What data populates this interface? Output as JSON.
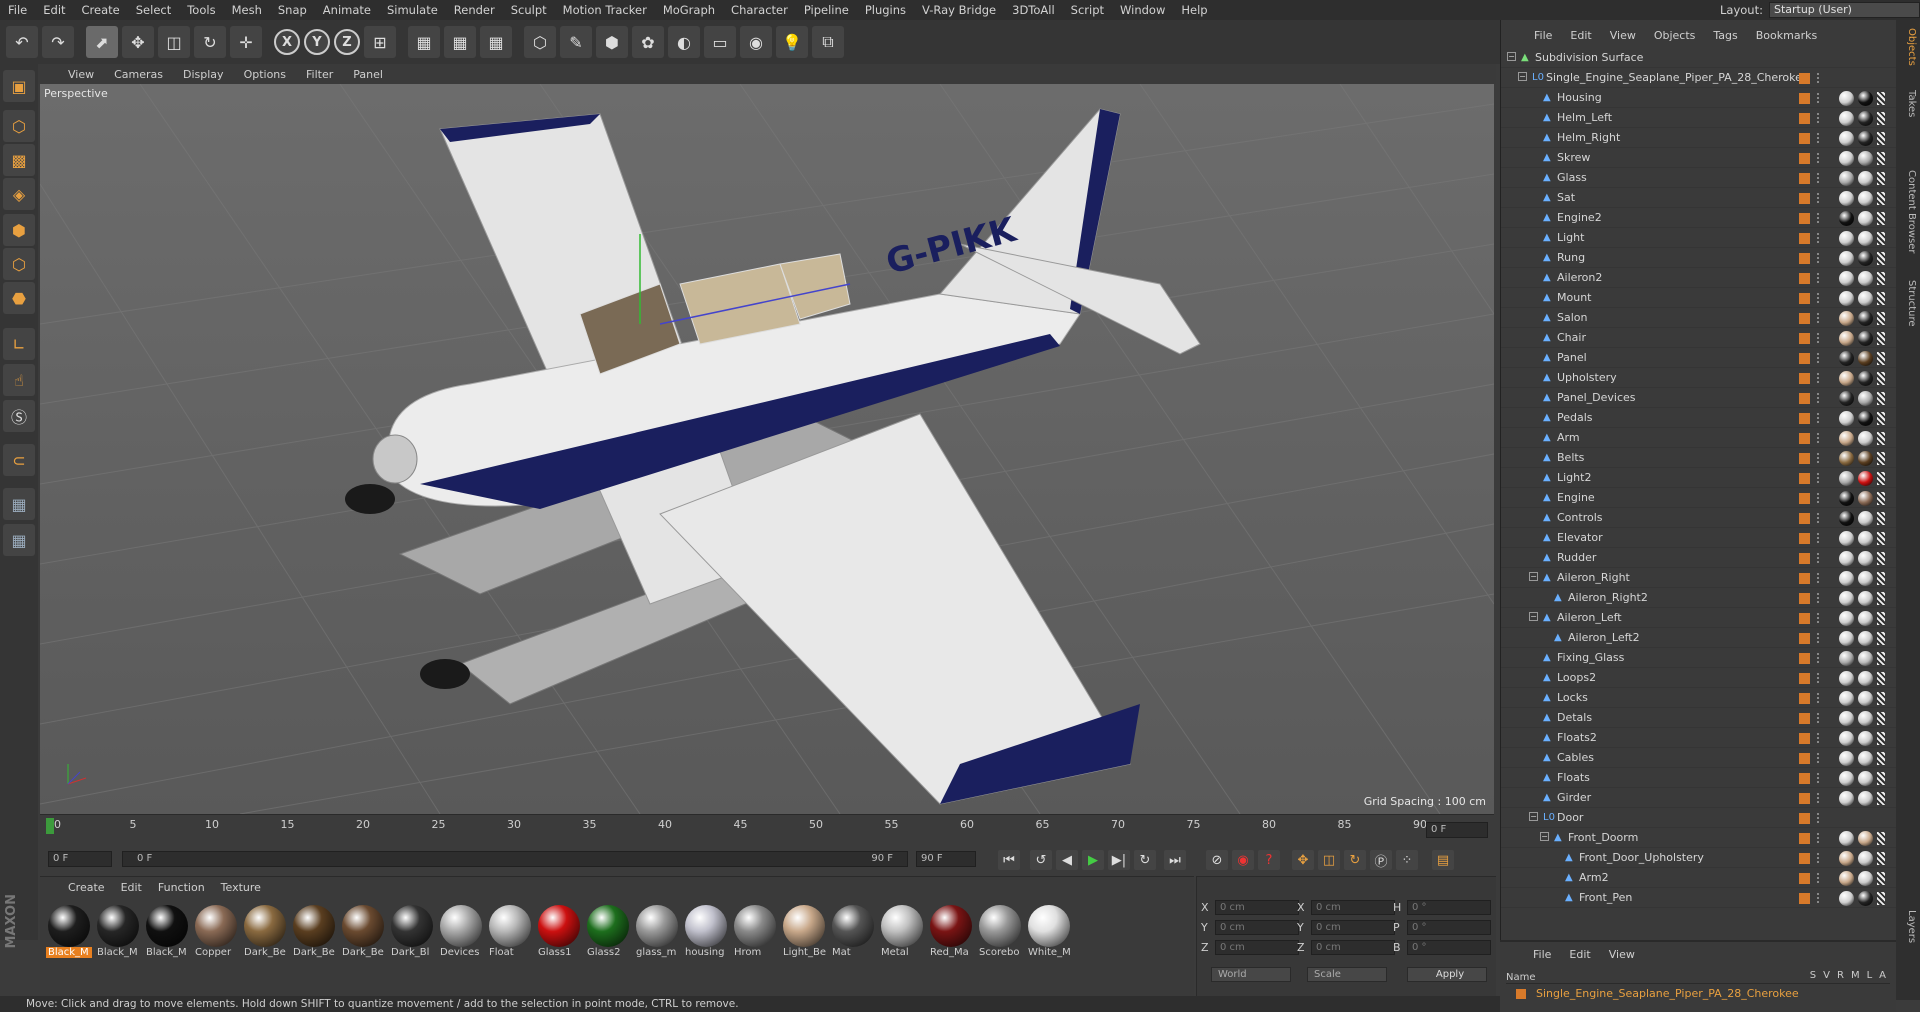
{
  "menubar": [
    "File",
    "Edit",
    "Create",
    "Select",
    "Tools",
    "Mesh",
    "Snap",
    "Animate",
    "Simulate",
    "Render",
    "Sculpt",
    "Motion Tracker",
    "MoGraph",
    "Character",
    "Pipeline",
    "Plugins",
    "V-Ray Bridge",
    "3DToAll",
    "Script",
    "Window",
    "Help"
  ],
  "layout": {
    "label": "Layout:",
    "value": "Startup (User)"
  },
  "toolbar_icons": [
    "undo-icon",
    "redo-icon",
    "live-select-icon",
    "move-icon",
    "scale-icon",
    "rotate-icon",
    "transform-icon",
    "x-axis-icon",
    "y-axis-icon",
    "z-axis-icon",
    "coordinate-system-icon",
    "render-view-icon",
    "render-picture-viewer-icon",
    "edit-render-settings-icon",
    "cube-icon",
    "pen-icon",
    "subdivision-icon",
    "array-icon",
    "deformer-icon",
    "floor-icon",
    "camera-icon",
    "light-icon",
    "python-icon"
  ],
  "toolbar_glyphs": [
    "↶",
    "↷",
    "⬈",
    "✥",
    "◫",
    "↻",
    "✛",
    "X",
    "Y",
    "Z",
    "⊞",
    "▦",
    "▦",
    "▦",
    "⬡",
    "✎",
    "⬢",
    "✿",
    "◐",
    "▭",
    "◉",
    "💡",
    "⧉"
  ],
  "viewport": {
    "menu": [
      "View",
      "Cameras",
      "Display",
      "Options",
      "Filter",
      "Panel"
    ],
    "label": "Perspective",
    "grid_spacing": "Grid Spacing : 100 cm",
    "tail_text": "G-PIKK"
  },
  "timeline": {
    "ticks": [
      "0",
      "5",
      "10",
      "15",
      "20",
      "25",
      "30",
      "35",
      "40",
      "45",
      "50",
      "55",
      "60",
      "65",
      "70",
      "75",
      "80",
      "85",
      "90"
    ],
    "end_frame": "0 F"
  },
  "playbar": {
    "current": "0 F",
    "range_start": "0 F",
    "range_end": "90 F",
    "max": "90 F"
  },
  "materials": {
    "menu": [
      "Create",
      "Edit",
      "Function",
      "Texture"
    ],
    "items": [
      {
        "name": "Black_M",
        "color": "#1e1e1e",
        "selected": true
      },
      {
        "name": "Black_M",
        "color": "#262626"
      },
      {
        "name": "Black_M",
        "color": "#101010"
      },
      {
        "name": "Copper",
        "color": "#8a6a55"
      },
      {
        "name": "Dark_Be",
        "color": "#8a6a40"
      },
      {
        "name": "Dark_Be",
        "color": "#5a3e20"
      },
      {
        "name": "Dark_Be",
        "color": "#6a4a30"
      },
      {
        "name": "Dark_Bl",
        "color": "#333333"
      },
      {
        "name": "Devices",
        "color": "#aaaaaa"
      },
      {
        "name": "Float",
        "color": "#b8b8b8"
      },
      {
        "name": "Glass1",
        "color": "#cc1010"
      },
      {
        "name": "Glass2",
        "color": "#1d6e1d"
      },
      {
        "name": "glass_m",
        "color": "#9a9a9a"
      },
      {
        "name": "housing",
        "color": "#c0c0cc"
      },
      {
        "name": "Hrom",
        "color": "#8a8a8a"
      },
      {
        "name": "Light_Be",
        "color": "#c8a88a"
      },
      {
        "name": "Mat",
        "color": "#555555"
      },
      {
        "name": "Metal",
        "color": "#c0c0c0"
      },
      {
        "name": "Red_Ma",
        "color": "#7a1414"
      },
      {
        "name": "Scorebo",
        "color": "#999999"
      },
      {
        "name": "White_M",
        "color": "#e0e0e0"
      }
    ]
  },
  "coords": {
    "rows": [
      {
        "a": "X",
        "av": "0 cm",
        "b": "X",
        "bv": "0 cm",
        "c": "H",
        "cv": "0 °"
      },
      {
        "a": "Y",
        "av": "0 cm",
        "b": "Y",
        "bv": "0 cm",
        "c": "P",
        "cv": "0 °"
      },
      {
        "a": "Z",
        "av": "0 cm",
        "b": "Z",
        "bv": "0 cm",
        "c": "B",
        "cv": "0 °"
      }
    ],
    "mode": "World",
    "scale": "Scale",
    "apply": "Apply"
  },
  "status": "Move: Click and drag to move elements. Hold down SHIFT to quantize movement / add to the selection in point mode, CTRL to remove.",
  "objects": {
    "menu": [
      "File",
      "Edit",
      "View",
      "Objects",
      "Tags",
      "Bookmarks"
    ],
    "rows": [
      {
        "name": "Subdivision Surface",
        "level": 0,
        "expand": "−",
        "kind": "sub"
      },
      {
        "name": "Single_Engine_Seaplane_Piper_PA_28_Cherokee",
        "level": 1,
        "expand": "−",
        "kind": "null"
      },
      {
        "name": "Housing",
        "level": 2,
        "t1": "#cfcfcf",
        "t2": "#111111"
      },
      {
        "name": "Helm_Left",
        "level": 2,
        "t1": "#cfcfcf",
        "t2": "#222222"
      },
      {
        "name": "Helm_Right",
        "level": 2,
        "t1": "#cfcfcf",
        "t2": "#222222"
      },
      {
        "name": "Skrew",
        "level": 2,
        "t1": "#cfcfcf",
        "t2": "#aaaaaa"
      },
      {
        "name": "Glass",
        "level": 2,
        "t1": "#aaaaaa",
        "t2": "#cccccc"
      },
      {
        "name": "Sat",
        "level": 2,
        "t1": "#cfcfcf",
        "t2": "#cfcfcf"
      },
      {
        "name": "Engine2",
        "level": 2,
        "t1": "#111111",
        "t2": "#cccccc"
      },
      {
        "name": "Light",
        "level": 2,
        "t1": "#cfcfcf",
        "t2": "#cfcfcf"
      },
      {
        "name": "Rung",
        "level": 2,
        "t1": "#cfcfcf",
        "t2": "#222222"
      },
      {
        "name": "Aileron2",
        "level": 2,
        "t1": "#cfcfcf",
        "t2": "#cccccc"
      },
      {
        "name": "Mount",
        "level": 2,
        "t1": "#cfcfcf",
        "t2": "#cccccc"
      },
      {
        "name": "Salon",
        "level": 2,
        "t1": "#c8a88a",
        "t2": "#222222"
      },
      {
        "name": "Chair",
        "level": 2,
        "t1": "#c8a88a",
        "t2": "#222222"
      },
      {
        "name": "Panel",
        "level": 2,
        "t1": "#222222",
        "t2": "#5a3e20"
      },
      {
        "name": "Upholstery",
        "level": 2,
        "t1": "#c8a88a",
        "t2": "#222222"
      },
      {
        "name": "Panel_Devices",
        "level": 2,
        "t1": "#222222",
        "t2": "#aaaaaa"
      },
      {
        "name": "Pedals",
        "level": 2,
        "t1": "#cfcfcf",
        "t2": "#111111"
      },
      {
        "name": "Arm",
        "level": 2,
        "t1": "#c8a88a",
        "t2": "#cccccc"
      },
      {
        "name": "Belts",
        "level": 2,
        "t1": "#8a6a40",
        "t2": "#5a3e20"
      },
      {
        "name": "Light2",
        "level": 2,
        "t1": "#aaaaaa",
        "t2": "#cc1010"
      },
      {
        "name": "Engine",
        "level": 2,
        "t1": "#111111",
        "t2": "#8a6a55"
      },
      {
        "name": "Controls",
        "level": 2,
        "t1": "#111111",
        "t2": "#cccccc"
      },
      {
        "name": "Elevator",
        "level": 2,
        "t1": "#cfcfcf",
        "t2": "#cccccc"
      },
      {
        "name": "Rudder",
        "level": 2,
        "t1": "#cfcfcf",
        "t2": "#cccccc"
      },
      {
        "name": "Aileron_Right",
        "level": 2,
        "expand": "−",
        "t1": "#cfcfcf",
        "t2": "#cccccc"
      },
      {
        "name": "Aileron_Right2",
        "level": 3,
        "t1": "#cfcfcf",
        "t2": "#cccccc"
      },
      {
        "name": "Aileron_Left",
        "level": 2,
        "expand": "−",
        "t1": "#cfcfcf",
        "t2": "#cccccc"
      },
      {
        "name": "Aileron_Left2",
        "level": 3,
        "t1": "#cfcfcf",
        "t2": "#cccccc"
      },
      {
        "name": "Fixing_Glass",
        "level": 2,
        "t1": "#aaaaaa",
        "t2": "#bbbbbb"
      },
      {
        "name": "Loops2",
        "level": 2,
        "t1": "#cfcfcf",
        "t2": "#cccccc"
      },
      {
        "name": "Locks",
        "level": 2,
        "t1": "#cfcfcf",
        "t2": "#cccccc"
      },
      {
        "name": "Detals",
        "level": 2,
        "t1": "#cfcfcf",
        "t2": "#cccccc"
      },
      {
        "name": "Floats2",
        "level": 2,
        "t1": "#cfcfcf",
        "t2": "#cccccc"
      },
      {
        "name": "Cables",
        "level": 2,
        "t1": "#cfcfcf",
        "t2": "#cccccc"
      },
      {
        "name": "Floats",
        "level": 2,
        "t1": "#cfcfcf",
        "t2": "#cccccc"
      },
      {
        "name": "Girder",
        "level": 2,
        "t1": "#cfcfcf",
        "t2": "#cccccc"
      },
      {
        "name": "Door",
        "level": 2,
        "expand": "−",
        "kind": "null"
      },
      {
        "name": "Front_Doorm",
        "level": 3,
        "expand": "−",
        "t1": "#cfcfcf",
        "t2": "#c8a88a"
      },
      {
        "name": "Front_Door_Upholstery",
        "level": 4,
        "t1": "#c8a88a",
        "t2": "#cccccc"
      },
      {
        "name": "Arm2",
        "level": 4,
        "t1": "#c8a88a",
        "t2": "#cccccc"
      },
      {
        "name": "Front_Pen",
        "level": 4,
        "t1": "#cfcfcf",
        "t2": "#222222"
      }
    ]
  },
  "layers": {
    "menu": [
      "File",
      "Edit",
      "View"
    ],
    "header": "Name",
    "cols": [
      "S",
      "V",
      "R",
      "M",
      "L",
      "A"
    ],
    "item": "Single_Engine_Seaplane_Piper_PA_28_Cherokee"
  },
  "side_tabs": [
    "Objects",
    "Takes",
    "Content Browser",
    "Structure",
    "Layers"
  ]
}
